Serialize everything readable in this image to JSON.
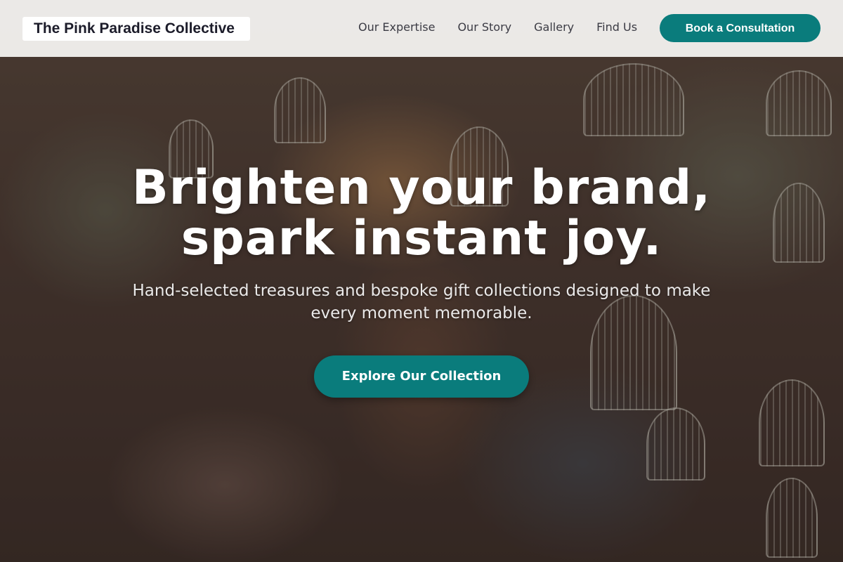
{
  "header": {
    "logo": "The Pink Paradise Collective",
    "nav": [
      {
        "label": "Our Expertise"
      },
      {
        "label": "Our Story"
      },
      {
        "label": "Gallery"
      },
      {
        "label": "Find Us"
      }
    ],
    "cta_label": "Book a Consultation"
  },
  "hero": {
    "title_line1": "Brighten your brand,",
    "title_line2": "spark instant joy.",
    "subtitle": "Hand-selected treasures and bespoke gift collections designed to make every moment memorable.",
    "button_label": "Explore Our Collection"
  },
  "colors": {
    "accent": "#0a7c7c",
    "header_bg": "#f5f4f2",
    "text_dark": "#1c1c2a"
  }
}
